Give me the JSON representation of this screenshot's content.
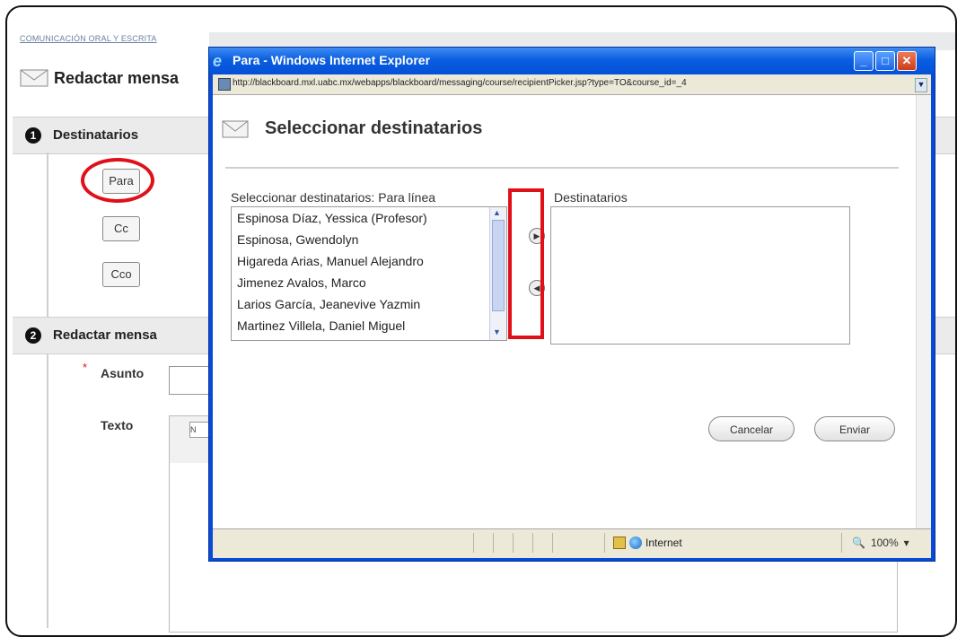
{
  "background": {
    "breadcrumb": "COMUNICACIÓN ORAL Y ESCRITA",
    "page_title": "Redactar mensa",
    "section1": {
      "number": "1",
      "label": "Destinatarios"
    },
    "recipient_buttons": [
      "Para",
      "Cc",
      "Cco"
    ],
    "section2": {
      "number": "2",
      "label": "Redactar mensa"
    },
    "asunto_label": "Asunto",
    "texto_label": "Texto",
    "toolbar_mini": "N"
  },
  "popup": {
    "window_title": "Para - Windows Internet Explorer",
    "address_url": "http://blackboard.mxl.uabc.mx/webapps/blackboard/messaging/course/recipientPicker.jsp?type=TO&course_id=_4",
    "heading": "Seleccionar destinatarios",
    "left_label": "Seleccionar destinatarios: Para línea",
    "right_label": "Destinatarios",
    "candidates": [
      "Espinosa Díaz, Yessica (Profesor)",
      "Espinosa, Gwendolyn",
      "Higareda Arias, Manuel Alejandro",
      "Jimenez Avalos, Marco",
      "Larios García, Jeanevive Yazmin",
      "Martinez Villela, Daniel Miguel"
    ],
    "cancel_label": "Cancelar",
    "send_label": "Enviar",
    "status_zone": "Internet",
    "zoom": "100%"
  },
  "colors": {
    "highlight": "#e0101a",
    "ie_blue": "#0a4ad8"
  }
}
